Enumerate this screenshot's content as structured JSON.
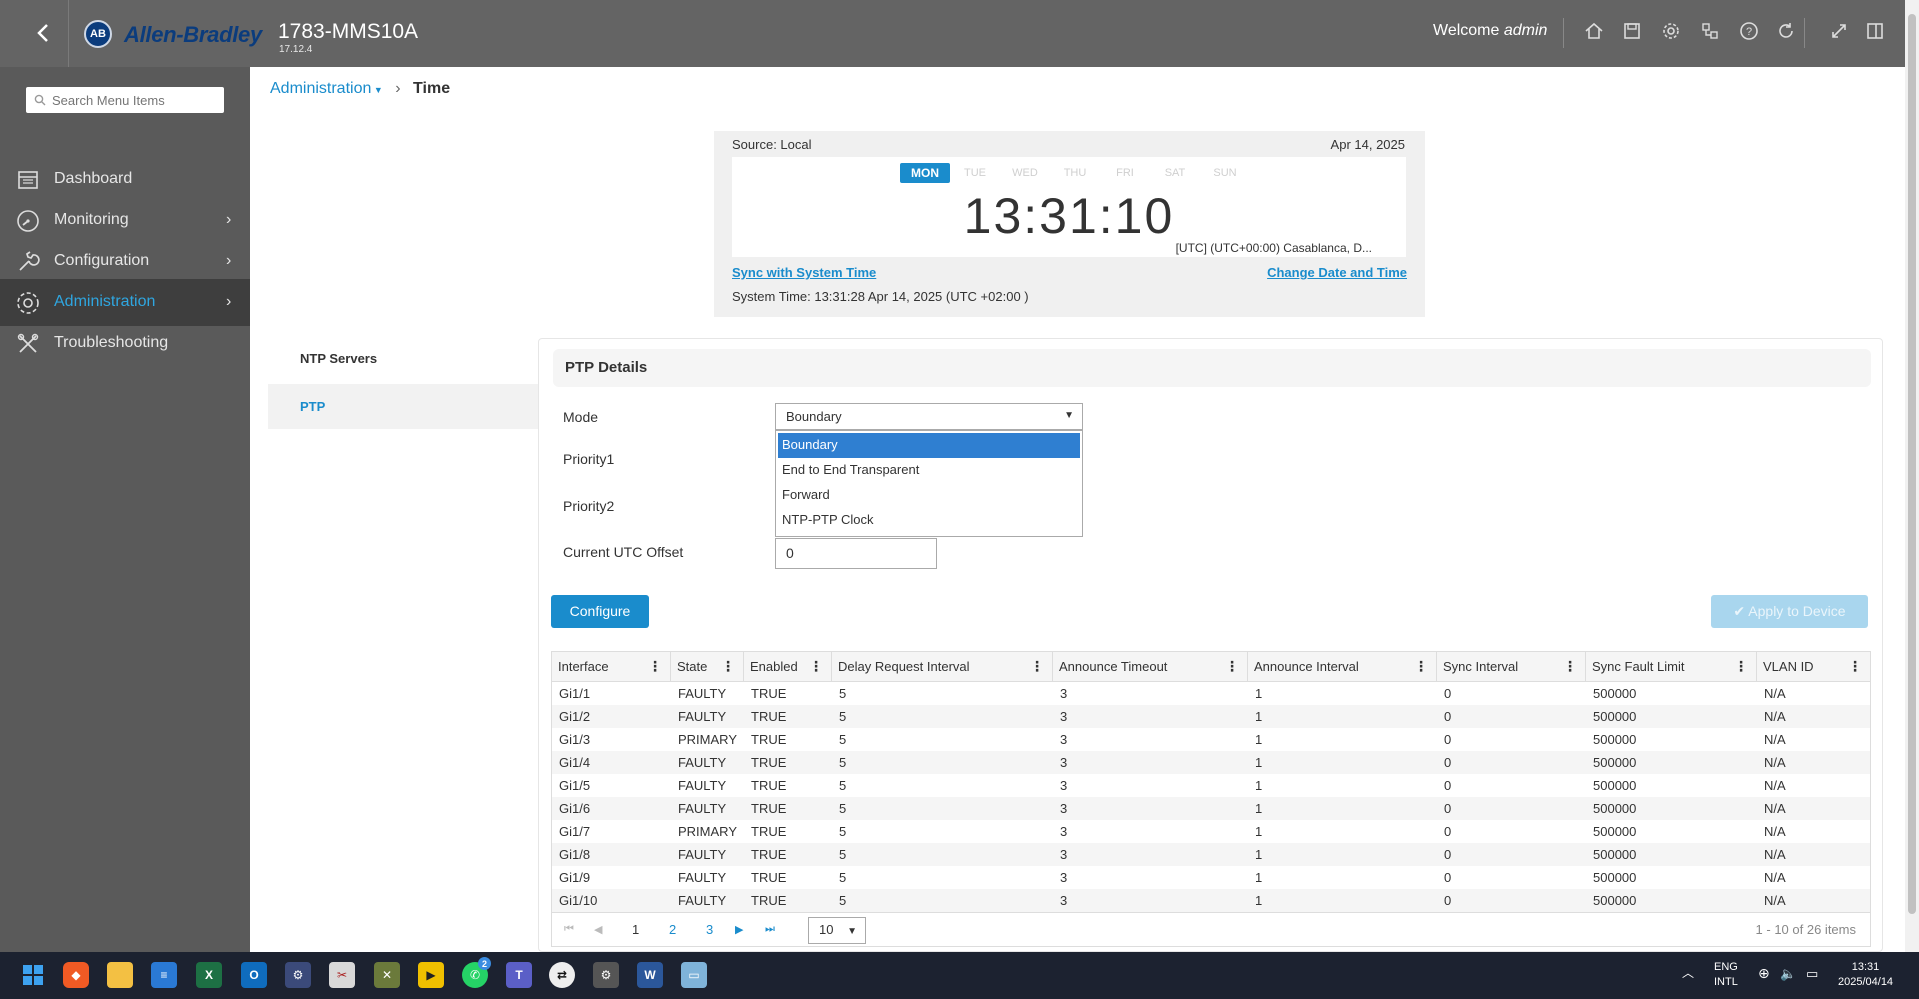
{
  "header": {
    "brand": "Allen-Bradley",
    "badge": "AB",
    "device_name": "1783-MMS10A",
    "version": "17.12.4",
    "welcome_prefix": "Welcome",
    "user": "admin"
  },
  "sidebar": {
    "search_placeholder": "Search Menu Items",
    "items": [
      {
        "label": "Dashboard"
      },
      {
        "label": "Monitoring"
      },
      {
        "label": "Configuration"
      },
      {
        "label": "Administration"
      },
      {
        "label": "Troubleshooting"
      }
    ]
  },
  "breadcrumb": {
    "parent": "Administration",
    "current": "Time"
  },
  "clock": {
    "source": "Source: Local",
    "date": "Apr 14, 2025",
    "days": [
      "MON",
      "TUE",
      "WED",
      "THU",
      "FRI",
      "SAT",
      "SUN"
    ],
    "time": "13:31:10",
    "timezone": "[UTC] (UTC+00:00) Casablanca, D...",
    "sync_link": "Sync with System Time",
    "change_link": "Change Date and Time",
    "system_time": "System Time: 13:31:28 Apr 14, 2025 (UTC +02:00 )"
  },
  "subnav": {
    "items": [
      {
        "label": "NTP Servers"
      },
      {
        "label": "PTP"
      }
    ]
  },
  "ptp": {
    "title": "PTP Details",
    "mode_label": "Mode",
    "mode_value": "Boundary",
    "mode_options": [
      "Boundary",
      "End to End Transparent",
      "Forward",
      "NTP-PTP Clock"
    ],
    "priority1_label": "Priority1",
    "priority2_label": "Priority2",
    "utc_label": "Current UTC Offset",
    "utc_value": "0",
    "configure_label": "Configure",
    "apply_label": "Apply to Device"
  },
  "table": {
    "columns": [
      "Interface",
      "State",
      "Enabled",
      "Delay Request Interval",
      "Announce Timeout",
      "Announce Interval",
      "Sync Interval",
      "Sync Fault Limit",
      "VLAN ID"
    ],
    "rows": [
      [
        "Gi1/1",
        "FAULTY",
        "TRUE",
        "5",
        "3",
        "1",
        "0",
        "500000",
        "N/A"
      ],
      [
        "Gi1/2",
        "FAULTY",
        "TRUE",
        "5",
        "3",
        "1",
        "0",
        "500000",
        "N/A"
      ],
      [
        "Gi1/3",
        "PRIMARY",
        "TRUE",
        "5",
        "3",
        "1",
        "0",
        "500000",
        "N/A"
      ],
      [
        "Gi1/4",
        "FAULTY",
        "TRUE",
        "5",
        "3",
        "1",
        "0",
        "500000",
        "N/A"
      ],
      [
        "Gi1/5",
        "FAULTY",
        "TRUE",
        "5",
        "3",
        "1",
        "0",
        "500000",
        "N/A"
      ],
      [
        "Gi1/6",
        "FAULTY",
        "TRUE",
        "5",
        "3",
        "1",
        "0",
        "500000",
        "N/A"
      ],
      [
        "Gi1/7",
        "PRIMARY",
        "TRUE",
        "5",
        "3",
        "1",
        "0",
        "500000",
        "N/A"
      ],
      [
        "Gi1/8",
        "FAULTY",
        "TRUE",
        "5",
        "3",
        "1",
        "0",
        "500000",
        "N/A"
      ],
      [
        "Gi1/9",
        "FAULTY",
        "TRUE",
        "5",
        "3",
        "1",
        "0",
        "500000",
        "N/A"
      ],
      [
        "Gi1/10",
        "FAULTY",
        "TRUE",
        "5",
        "3",
        "1",
        "0",
        "500000",
        "N/A"
      ]
    ],
    "pages": [
      "1",
      "2",
      "3"
    ],
    "page_size": "10",
    "info": "1 - 10 of 26 items"
  },
  "taskbar": {
    "lang": "ENG",
    "layout": "INTL",
    "time": "13:31",
    "date": "2025/04/14",
    "whatsapp_badge": "2"
  },
  "colors": {
    "accent": "#1a8ccc",
    "header": "#646464",
    "sidebar": "#5a5a5a"
  }
}
